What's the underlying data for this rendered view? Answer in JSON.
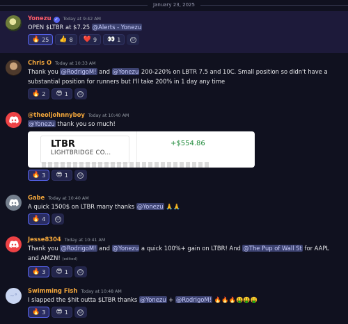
{
  "date_divider": "January 23, 2025",
  "colors": {
    "mention_bg": "#3c4270",
    "discord_red": "#ed4245",
    "gain_green": "#1f8a3a"
  },
  "messages": [
    {
      "author": "Yonezu",
      "author_color": "#ff5c6a",
      "verified": true,
      "timestamp": "Today at 9:42 AM",
      "avatar_icon": "trader-avatar-icon",
      "text_parts": [
        "OPEN $LTBR at $7.25 ",
        "@Alerts - Yonezu"
      ],
      "reactions": [
        {
          "emoji": "🔥",
          "count": "25",
          "icon": "fire-icon"
        },
        {
          "emoji": "👍",
          "count": "8",
          "icon": "thumbs-up-icon"
        },
        {
          "emoji": "❤️",
          "count": "9",
          "icon": "heart-icon"
        },
        {
          "emoji": "👀",
          "count": "1",
          "icon": "eyes-icon"
        }
      ]
    },
    {
      "author": "Chris O",
      "author_color": "#f2a63b",
      "timestamp": "Today at 10:33 AM",
      "text_parts": [
        "Thank you ",
        "@RodrigoM!",
        " and ",
        "@Yonezu",
        " 200-220% on LBTR 7.5 and 10C. Small position so didn't have a substantial position for runners but I'll take 200% in 1 day any time"
      ],
      "reactions": [
        {
          "emoji": "🔥",
          "count": "2",
          "icon": "fire-icon"
        },
        {
          "emoji": "😎",
          "count": "1",
          "icon": "sunglasses-icon"
        }
      ]
    },
    {
      "author": "@theoljohnnyboy",
      "author_color": "#f2a63b",
      "timestamp": "Today at 10:40 AM",
      "text_parts": [
        "@Yonezu",
        " thank you so much!"
      ],
      "embed": {
        "ticker": "LTBR",
        "company": "LIGHTBRIDGE CO...",
        "gain": "+$554.86"
      },
      "reactions": [
        {
          "emoji": "🔥",
          "count": "3",
          "icon": "fire-icon"
        },
        {
          "emoji": "😎",
          "count": "1",
          "icon": "sunglasses-icon"
        }
      ]
    },
    {
      "author": "Gabe",
      "author_color": "#f2a63b",
      "timestamp": "Today at 10:40 AM",
      "text_parts": [
        "A quick 1500$ on LTBR many thanks ",
        "@Yonezu",
        " 🙏🙏"
      ],
      "reactions": [
        {
          "emoji": "🔥",
          "count": "4",
          "icon": "fire-icon"
        }
      ]
    },
    {
      "author": "Jesse8304",
      "author_color": "#f2a63b",
      "timestamp": "Today at 10:41 AM",
      "text_parts": [
        "Thank you ",
        "@RodrigoM!",
        " and ",
        "@Yonezu",
        " a quick 100%+ gain on LTBR! And ",
        "@The Pup of Wall St",
        " for AAPL and AMZN!"
      ],
      "edited": "(edited)",
      "reactions": [
        {
          "emoji": "🔥",
          "count": "3",
          "icon": "fire-icon"
        },
        {
          "emoji": "😎",
          "count": "1",
          "icon": "sunglasses-icon"
        }
      ]
    },
    {
      "author": "Swimming Fish",
      "author_color": "#f2a63b",
      "timestamp": "Today at 10:48 AM",
      "text_parts": [
        "I slapped the $hit outta $LTBR thanks ",
        "@Yonezu",
        " + ",
        "@RodrigoM!",
        " 🔥🔥🔥🤑🤑🤑"
      ],
      "reactions": [
        {
          "emoji": "🔥",
          "count": "3",
          "icon": "fire-icon"
        },
        {
          "emoji": "😎",
          "count": "1",
          "icon": "sunglasses-icon"
        }
      ]
    }
  ]
}
